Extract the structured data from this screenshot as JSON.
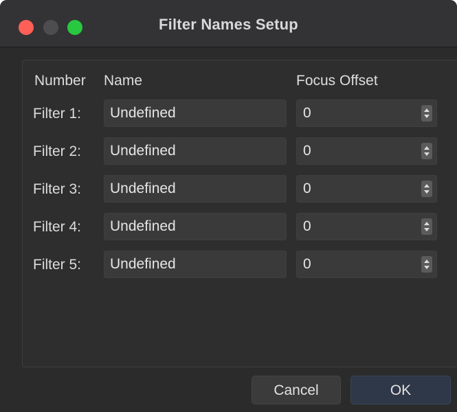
{
  "window": {
    "title": "Filter Names Setup"
  },
  "headers": {
    "number": "Number",
    "name": "Name",
    "focus_offset": "Focus Offset"
  },
  "filters": [
    {
      "label": "Filter 1:",
      "name": "Undefined",
      "offset": "0"
    },
    {
      "label": "Filter 2:",
      "name": "Undefined",
      "offset": "0"
    },
    {
      "label": "Filter 3:",
      "name": "Undefined",
      "offset": "0"
    },
    {
      "label": "Filter 4:",
      "name": "Undefined",
      "offset": "0"
    },
    {
      "label": "Filter 5:",
      "name": "Undefined",
      "offset": "0"
    }
  ],
  "buttons": {
    "cancel": "Cancel",
    "ok": "OK"
  },
  "icons": {
    "close": "close-icon",
    "minimize": "minimize-icon",
    "zoom": "zoom-icon",
    "stepper": "up-down-arrows-icon"
  },
  "colors": {
    "close": "#fe5f57",
    "minimize": "#4d4d4f",
    "zoom": "#28c840",
    "window_bg": "#2b2b2b",
    "ok_button": "#2f3848"
  }
}
